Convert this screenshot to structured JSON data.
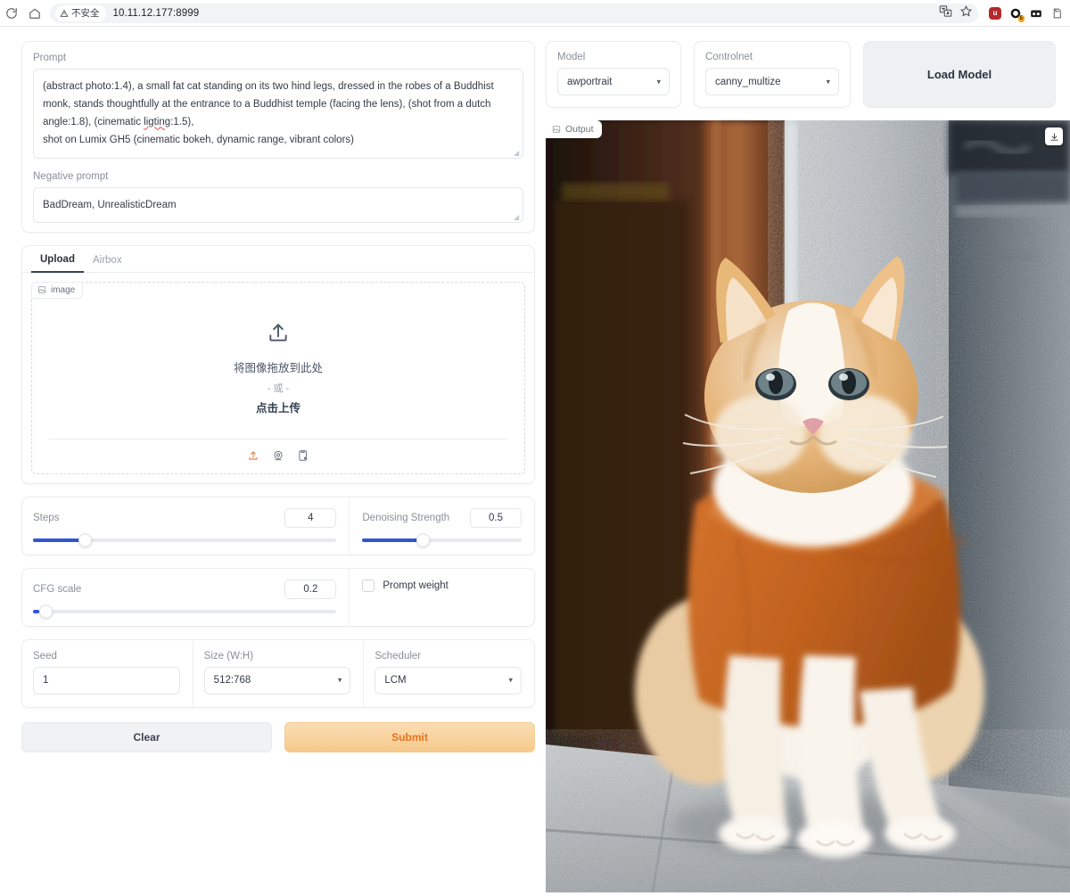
{
  "browser": {
    "reload_icon": "reload-icon",
    "home_icon": "home-icon",
    "security_label": "不安全",
    "warning_icon": "warning-triangle-icon",
    "url": "10.11.12.177:8999",
    "translate_icon": "translate-icon",
    "bookmark_icon": "star-icon",
    "extensions": [
      {
        "name": "ublock-origin-icon",
        "glyph": "u",
        "color": "#b5292c"
      },
      {
        "name": "dark-reader-icon",
        "glyph": "",
        "color": "#141414",
        "badge": "5",
        "badge_color": "#f5a623"
      },
      {
        "name": "tampermonkey-icon",
        "glyph": "",
        "color": "#1c1c1c"
      },
      {
        "name": "clipper-icon",
        "glyph": "",
        "color": "#5c5c5c"
      }
    ]
  },
  "left": {
    "prompt": {
      "label": "Prompt",
      "line1": "(abstract photo:1.4), a small fat cat standing on its two hind legs, dressed in the robes of a Buddhist monk, stands thoughtfully at the entrance to a Buddhist temple (facing the lens), (shot from a dutch angle:1.8), (cinematic ",
      "misspelled": "ligting",
      "line1_tail": ":1.5),",
      "line2": "shot on Lumix GH5 (cinematic bokeh, dynamic range, vibrant colors)"
    },
    "negative_prompt": {
      "label": "Negative prompt",
      "value": "BadDream, UnrealisticDream"
    },
    "tabs": [
      {
        "label": "Upload",
        "active": true
      },
      {
        "label": "Airbox",
        "active": false
      }
    ],
    "upload": {
      "badge_label": "image",
      "badge_icon": "image-placeholder-icon",
      "drop_icon": "upload-arrow-icon",
      "drop_text": "将图像拖放到此处",
      "or_text": "- 或 -",
      "click_text": "点击上传",
      "actions": [
        {
          "name": "upload-icon",
          "color": "#ef7a35"
        },
        {
          "name": "webcam-icon",
          "color": "#6b7280"
        },
        {
          "name": "paste-clipboard-icon",
          "color": "#6b7280"
        }
      ]
    },
    "sliders": [
      {
        "label": "Steps",
        "value": "4",
        "percent": 17
      },
      {
        "label": "Denoising Strength",
        "value": "0.5",
        "percent": 38
      },
      {
        "label": "CFG scale",
        "value": "0.2",
        "percent": 2
      }
    ],
    "prompt_weight": {
      "label": "Prompt weight",
      "checked": false
    },
    "seed": {
      "label": "Seed",
      "value": "1"
    },
    "size": {
      "label": "Size (W:H)",
      "value": "512:768"
    },
    "scheduler": {
      "label": "Scheduler",
      "value": "LCM"
    },
    "buttons": {
      "clear": "Clear",
      "submit": "Submit"
    }
  },
  "right": {
    "model": {
      "label": "Model",
      "value": "awportrait"
    },
    "controlnet": {
      "label": "Controlnet",
      "value": "canny_multize"
    },
    "load_model": "Load Model",
    "output": {
      "badge_label": "Output",
      "badge_icon": "image-placeholder-icon",
      "download_icon": "download-icon",
      "description": "Orange and white cat in orange monk robe sitting on stone steps at a temple entrance"
    }
  },
  "colors": {
    "accent_blue": "#2f55d4",
    "accent_orange": "#ef7a35",
    "submit_text": "#e8711f",
    "robe_orange": "#c96a28"
  }
}
